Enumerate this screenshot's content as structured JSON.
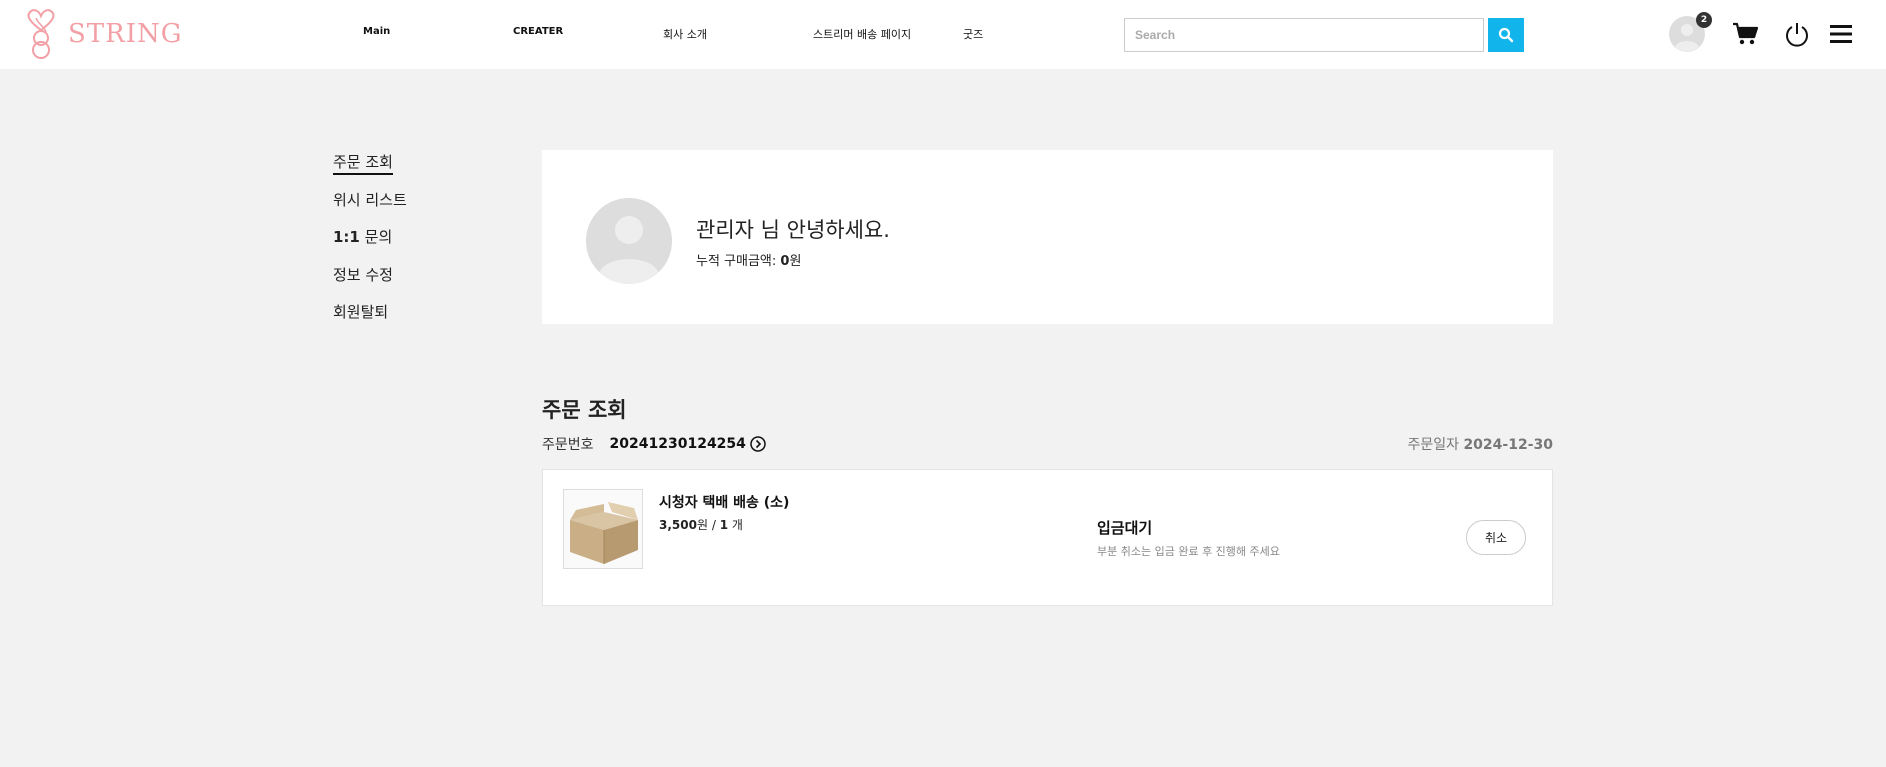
{
  "header": {
    "logo_text": "STRING",
    "nav": [
      {
        "label": "Main"
      },
      {
        "label": "CREATER"
      },
      {
        "label": "회사 소개"
      },
      {
        "label": "스트리머 배송 페이지"
      },
      {
        "label": "굿즈"
      }
    ],
    "search": {
      "placeholder": "Search",
      "value": ""
    },
    "account_badge": "2",
    "icons": [
      "search-icon",
      "avatar-icon",
      "cart-icon",
      "power-icon",
      "menu-icon"
    ]
  },
  "sidebar": {
    "items": [
      {
        "label": "주문 조회",
        "active": true
      },
      {
        "label": "위시 리스트"
      },
      {
        "label_num": "1:1",
        "label_text": " 문의"
      },
      {
        "label": "정보 수정"
      },
      {
        "label": "회원탈퇴"
      }
    ]
  },
  "profile": {
    "greeting": "관리자 님 안녕하세요.",
    "total_label": "누적 구매금액: ",
    "total_value": "0",
    "total_unit": "원"
  },
  "orders": {
    "title": "주문 조회",
    "order_no_label": "주문번호",
    "order_no": "20241230124254",
    "date_label": "주문일자 ",
    "date": "2024-12-30",
    "item": {
      "name": "시청자 택배 배송 (소)",
      "price": "3,500",
      "price_unit": "원 / ",
      "qty": "1",
      "qty_unit": " 개",
      "status": "입금대기",
      "status_note": "부분 취소는 입금 완료 후 진행해 주세요",
      "cancel_label": "취소"
    }
  },
  "colors": {
    "brand_pink": "#f2a0a6",
    "search_button": "#12b4ec",
    "background": "#f2f2f2"
  }
}
